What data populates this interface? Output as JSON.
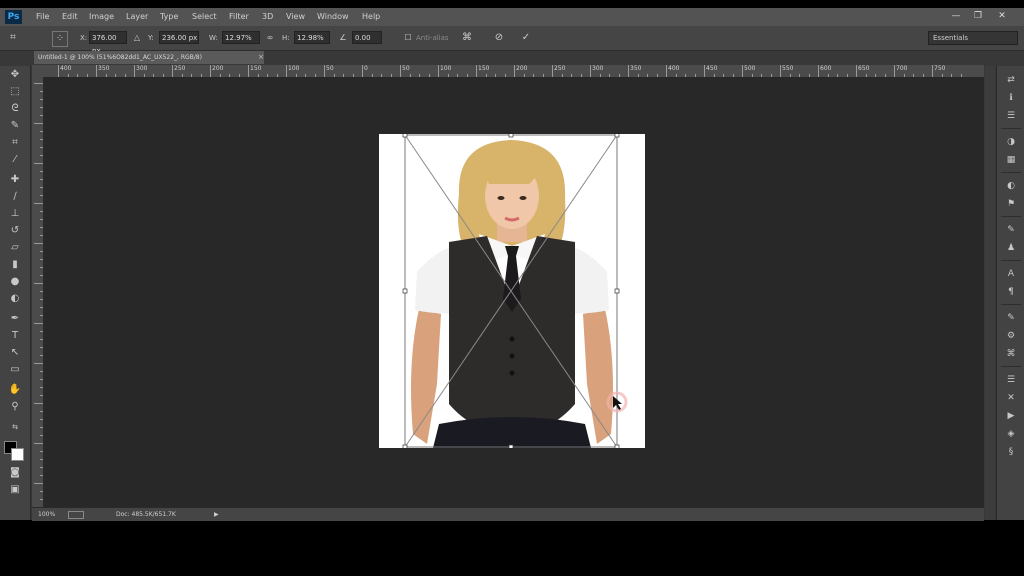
{
  "app": {
    "logo": "Ps"
  },
  "menu": [
    "File",
    "Edit",
    "Image",
    "Layer",
    "Type",
    "Select",
    "Filter",
    "3D",
    "View",
    "Window",
    "Help"
  ],
  "window_controls": {
    "minimize": "—",
    "restore": "❐",
    "close": "✕"
  },
  "options": {
    "x_label": "X:",
    "x_value": "376.00 px",
    "y_label": "Y:",
    "y_value": "236.00 px",
    "w_label": "W:",
    "w_value": "12.97%",
    "h_label": "H:",
    "h_value": "12.98%",
    "angle_value": "0.00",
    "antialias_label": "Anti-alias",
    "workspace": "Essentials"
  },
  "document": {
    "tab_title": "Untitled-1 @ 100% (51%6O82dd1_AC_UX522_, RGB/8)",
    "tab_close": "×"
  },
  "ruler_h": [
    "400",
    "350",
    "300",
    "250",
    "200",
    "150",
    "100",
    "50",
    "0",
    "50",
    "100",
    "150",
    "200",
    "250",
    "300",
    "350",
    "400",
    "450",
    "500",
    "550",
    "600",
    "650",
    "700",
    "750"
  ],
  "status": {
    "zoom": "100%",
    "doc": "Doc: 485.5K/651.7K",
    "arrow": "▶"
  },
  "icons": {
    "tools": [
      "move-icon",
      "marquee-icon",
      "lasso-icon",
      "quick-select-icon",
      "crop-icon",
      "eyedropper-icon",
      "healing-icon",
      "brush-icon",
      "clone-stamp-icon",
      "history-brush-icon",
      "eraser-icon",
      "gradient-icon",
      "blur-icon",
      "dodge-icon",
      "pen-icon",
      "type-icon",
      "path-select-icon",
      "shape-icon",
      "hand-icon",
      "zoom-icon"
    ],
    "dock": [
      "history-icon",
      "info-icon",
      "layer-comps-icon",
      "color-icon",
      "swatches-icon",
      "adjustments-icon",
      "styles-icon",
      "brush-panel-icon",
      "clone-source-icon",
      "character-icon",
      "paragraph-icon",
      "notes-icon",
      "channels-icon",
      "paths-icon",
      "actions-icon",
      "tool-presets-icon",
      "layers-icon",
      "properties-icon"
    ]
  }
}
